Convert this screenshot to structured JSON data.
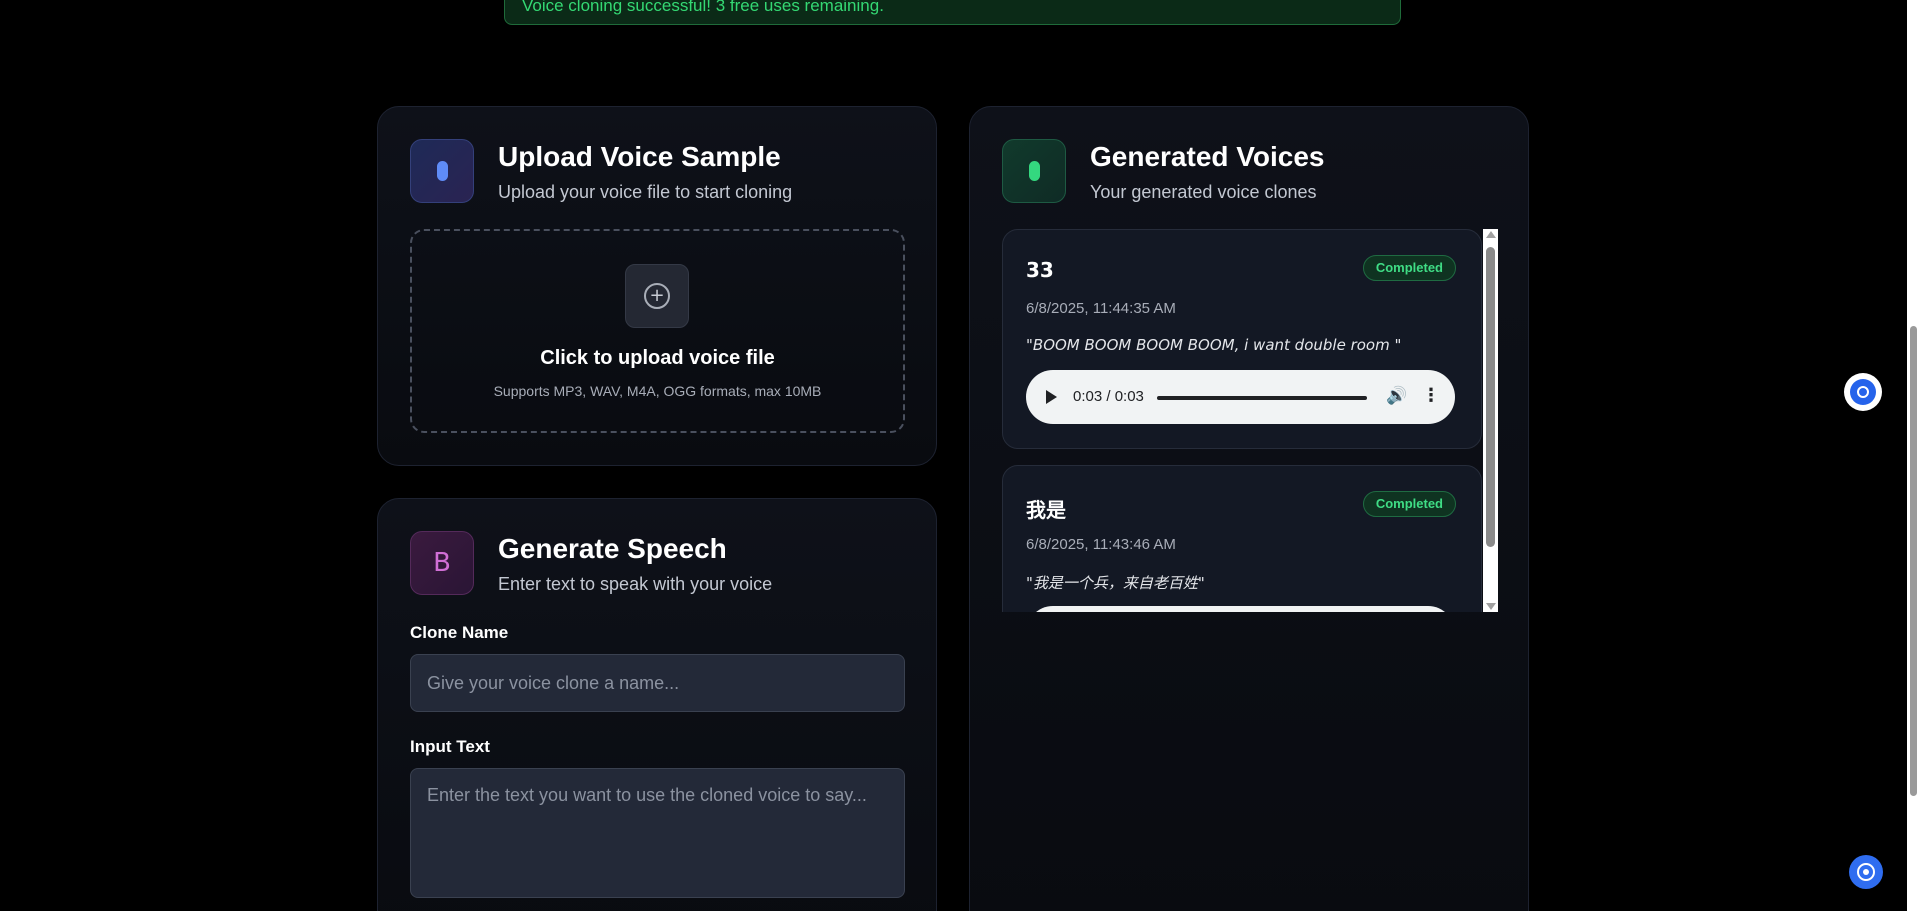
{
  "banner": {
    "message": "Voice cloning successful! 3 free uses remaining."
  },
  "upload_card": {
    "title": "Upload Voice Sample",
    "subtitle": "Upload your voice file to start cloning",
    "dropzone_title": "Click to upload voice file",
    "dropzone_hint": "Supports MP3, WAV, M4A, OGG formats, max 10MB"
  },
  "speech_card": {
    "title": "Generate Speech",
    "subtitle": "Enter text to speak with your voice",
    "icon_letter": "B",
    "clone_name_label": "Clone Name",
    "clone_name_placeholder": "Give your voice clone a name...",
    "clone_name_value": "",
    "input_text_label": "Input Text",
    "input_text_placeholder": "Enter the text you want to use the cloned voice to say...",
    "input_text_value": ""
  },
  "voices_card": {
    "title": "Generated Voices",
    "subtitle": "Your generated voice clones",
    "items": [
      {
        "name": "33",
        "status": "Completed",
        "date": "6/8/2025, 11:44:35 AM",
        "quote": "\"BOOM BOOM BOOM BOOM, i want double room \"",
        "audio_time": "0:03 / 0:03"
      },
      {
        "name": "我是",
        "status": "Completed",
        "date": "6/8/2025, 11:43:46 AM",
        "quote": "\"我是一个兵，来自老百姓\"",
        "audio_time": ""
      }
    ]
  },
  "colors": {
    "background": "#000000",
    "accent_green": "#34d873",
    "accent_blue": "#5f8cf7",
    "accent_purple": "#d16fd6"
  },
  "icons": {
    "upload": "plus-circle-icon",
    "floating": "chat-bubble-icon",
    "assistant": "target-icon"
  }
}
